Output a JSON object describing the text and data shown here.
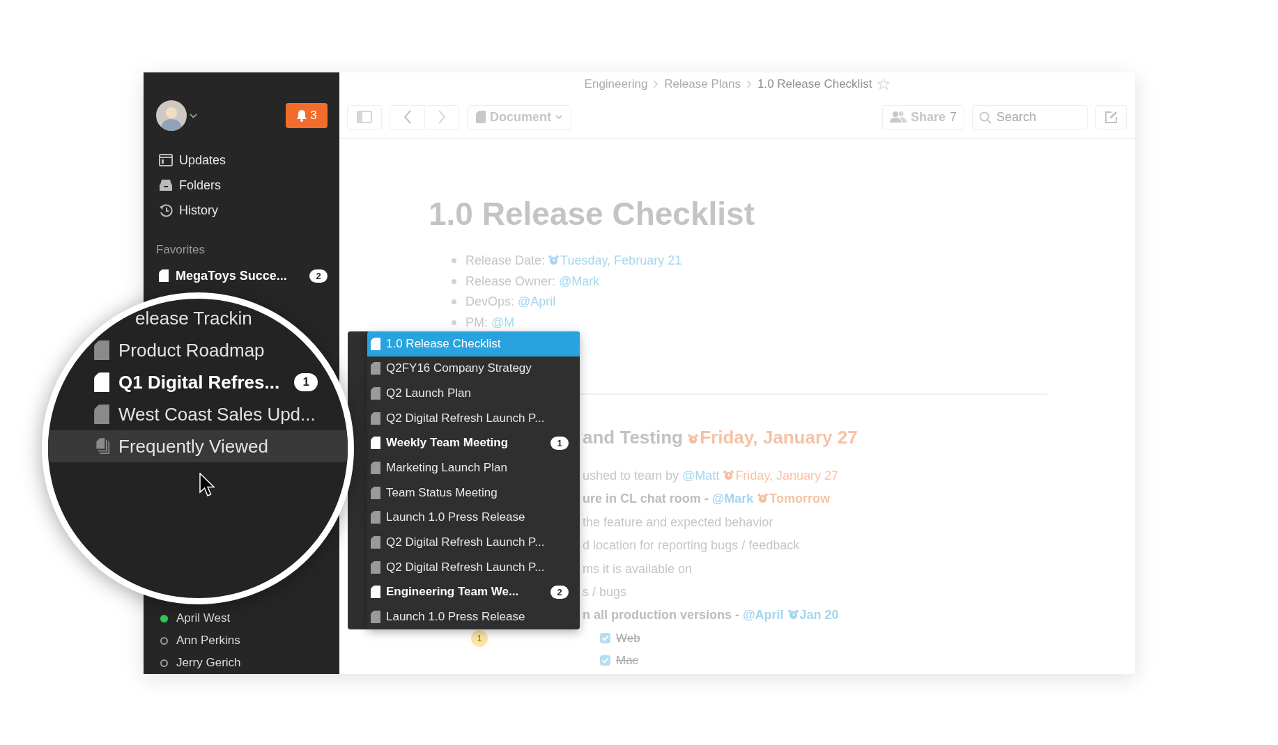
{
  "sidebar": {
    "notifications": {
      "count": "3"
    },
    "nav": [
      {
        "kind": "updates",
        "label": "Updates"
      },
      {
        "kind": "folders",
        "label": "Folders"
      },
      {
        "kind": "history",
        "label": "History"
      }
    ],
    "favorites": {
      "title": "Favorites",
      "items": [
        {
          "label": "MegaToys Succe...",
          "unread": true,
          "badge": "2"
        }
      ]
    },
    "people": [
      {
        "name": "April West",
        "online": true
      },
      {
        "name": "Ann Perkins",
        "online": false
      },
      {
        "name": "Jerry Gerich",
        "online": false
      }
    ]
  },
  "magnifier": {
    "items": [
      {
        "kind": "cut",
        "label": "elease Trackin",
        "unread": false,
        "hovered": false
      },
      {
        "kind": "doc",
        "label": "Product Roadmap",
        "unread": false,
        "hovered": false
      },
      {
        "kind": "doc",
        "label": "Q1 Digital Refres...",
        "unread": true,
        "hovered": false,
        "badge": "1"
      },
      {
        "kind": "doc",
        "label": "West Coast Sales Upd...",
        "unread": false,
        "hovered": false
      },
      {
        "kind": "stack",
        "label": "Frequently Viewed",
        "unread": false,
        "hovered": true
      }
    ]
  },
  "breadcrumb": {
    "items": [
      {
        "label": "Engineering",
        "current": false
      },
      {
        "label": "Release Plans",
        "current": false
      },
      {
        "label": "1.0 Release Checklist",
        "current": true
      }
    ],
    "starred": false
  },
  "toolbar": {
    "document_menu": "Document",
    "share": {
      "label": "Share",
      "count": "7"
    },
    "search": {
      "placeholder": "Search"
    }
  },
  "document": {
    "title": "1.0 Release Checklist",
    "details": [
      {
        "segments": [
          {
            "kind": "text",
            "text": "Release Date: "
          },
          {
            "kind": "date",
            "text": "Tuesday, February 21"
          }
        ]
      },
      {
        "segments": [
          {
            "kind": "text",
            "text": "Release Owner: "
          },
          {
            "kind": "mention",
            "text": "@Mark"
          }
        ]
      },
      {
        "segments": [
          {
            "kind": "text",
            "text": "DevOps: "
          },
          {
            "kind": "mention",
            "text": "@April"
          }
        ]
      },
      {
        "segments": [
          {
            "kind": "text",
            "text": "PM: "
          },
          {
            "kind": "mention",
            "text": "@M"
          }
        ]
      }
    ],
    "section": {
      "segments": [
        {
          "kind": "text",
          "text": "and Testing "
        },
        {
          "kind": "due",
          "text": "Friday, January 27"
        }
      ]
    },
    "tasks": [
      {
        "bold": false,
        "segments": [
          {
            "kind": "text",
            "text": "ushed to team by "
          },
          {
            "kind": "mention",
            "text": "@Matt"
          },
          {
            "kind": "due",
            "text": "Friday, January 27"
          }
        ]
      },
      {
        "bold": true,
        "segments": [
          {
            "kind": "text",
            "text": "ure in CL chat room - "
          },
          {
            "kind": "mention",
            "text": "@Mark"
          },
          {
            "kind": "due",
            "text": "Tomorrow"
          }
        ]
      },
      {
        "bold": false,
        "segments": [
          {
            "kind": "text",
            "text": "the feature and expected behavior"
          }
        ]
      },
      {
        "bold": false,
        "segments": [
          {
            "kind": "text",
            "text": "d location for reporting bugs / feedback"
          }
        ]
      },
      {
        "bold": false,
        "segments": [
          {
            "kind": "text",
            "text": "ms it is available on"
          }
        ]
      },
      {
        "bold": false,
        "segments": [
          {
            "kind": "text",
            "text": "s / bugs"
          }
        ]
      },
      {
        "bold": true,
        "segments": [
          {
            "kind": "text",
            "text": "n all production versions - "
          },
          {
            "kind": "mention",
            "text": "@April"
          },
          {
            "kind": "date",
            "text": "Jan 20"
          }
        ]
      }
    ],
    "comment_count": "1",
    "checklist": [
      {
        "label": "Web",
        "checked": true
      },
      {
        "label": "Mac",
        "checked": true
      }
    ]
  },
  "switcher": {
    "items": [
      {
        "label": "1.0 Release Checklist",
        "selected": true,
        "unread": false
      },
      {
        "label": "Q2FY16 Company Strategy",
        "selected": false,
        "unread": false
      },
      {
        "label": "Q2 Launch Plan",
        "selected": false,
        "unread": false
      },
      {
        "label": "Q2 Digital Refresh Launch P...",
        "selected": false,
        "unread": false
      },
      {
        "label": "Weekly Team Meeting",
        "selected": false,
        "unread": true,
        "badge": "1"
      },
      {
        "label": "Marketing Launch Plan",
        "selected": false,
        "unread": false
      },
      {
        "label": "Team Status Meeting",
        "selected": false,
        "unread": false
      },
      {
        "label": "Launch 1.0 Press Release",
        "selected": false,
        "unread": false
      },
      {
        "label": "Q2 Digital Refresh Launch P...",
        "selected": false,
        "unread": false
      },
      {
        "label": "Q2 Digital Refresh Launch P...",
        "selected": false,
        "unread": false
      },
      {
        "label": "Engineering Team We...",
        "selected": false,
        "unread": true,
        "badge": "2"
      },
      {
        "label": "Launch 1.0 Press Release",
        "selected": false,
        "unread": false
      }
    ]
  }
}
